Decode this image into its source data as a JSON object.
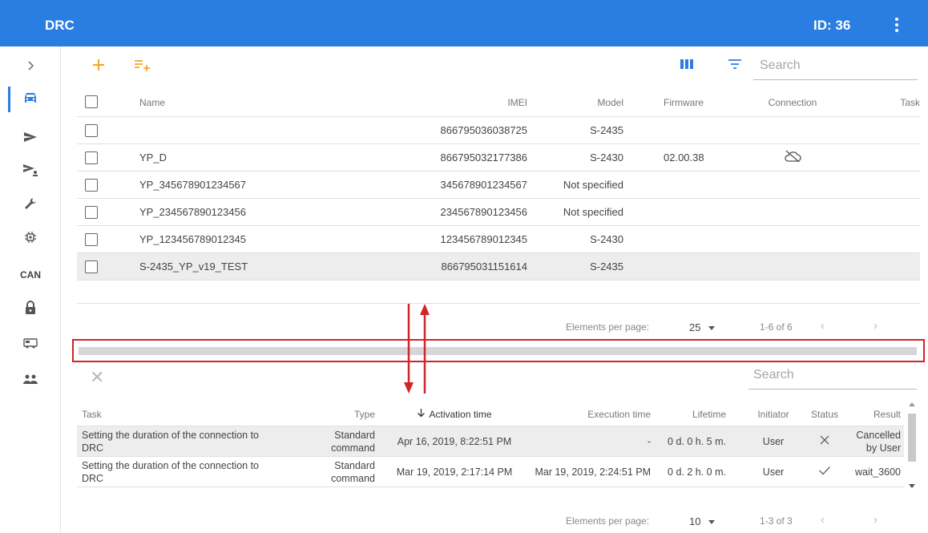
{
  "app": {
    "title": "DRC",
    "id_label": "ID: 36",
    "accent_color": "#2a7de1",
    "highlight_color": "#d0252a"
  },
  "sidebar": {
    "items": [
      {
        "name": "expand-icon"
      },
      {
        "name": "car-icon",
        "active": true
      },
      {
        "name": "send-icon"
      },
      {
        "name": "send-group-icon"
      },
      {
        "name": "wrench-icon"
      },
      {
        "name": "chip-icon"
      },
      {
        "name": "can-icon",
        "label": "CAN"
      },
      {
        "name": "lock-icon"
      },
      {
        "name": "truck-icon"
      },
      {
        "name": "users-icon"
      }
    ]
  },
  "toolbar": {
    "add_icon": "plus-icon",
    "add_list_icon": "playlist-add-icon",
    "columns_icon": "columns-icon",
    "filter_icon": "filter-icon",
    "search_placeholder": "Search"
  },
  "devices": {
    "columns": [
      "Name",
      "IMEI",
      "Model",
      "Firmware",
      "Connection",
      "Task"
    ],
    "rows": [
      {
        "name": "",
        "imei": "866795036038725",
        "model": "S-2435",
        "firmware": "",
        "connection": ""
      },
      {
        "name": "YP_D",
        "imei": "866795032177386",
        "model": "S-2430",
        "firmware": "02.00.38",
        "connection": "cloud-off-icon"
      },
      {
        "name": "YP_345678901234567",
        "imei": "345678901234567",
        "model": "Not specified",
        "firmware": "",
        "connection": ""
      },
      {
        "name": "YP_234567890123456",
        "imei": "234567890123456",
        "model": "Not specified",
        "firmware": "",
        "connection": ""
      },
      {
        "name": "YP_123456789012345",
        "imei": "123456789012345",
        "model": "S-2430",
        "firmware": "",
        "connection": ""
      },
      {
        "name": "S-2435_YP_v19_TEST",
        "imei": "866795031151614",
        "model": "S-2435",
        "firmware": "",
        "connection": ""
      }
    ],
    "pager": {
      "label": "Elements per page:",
      "per_page": "25",
      "range": "1-6 of 6"
    }
  },
  "tasks": {
    "search_placeholder": "Search",
    "columns": [
      "Task",
      "Type",
      "Activation time",
      "Execution time",
      "Lifetime",
      "Initiator",
      "Status",
      "Result"
    ],
    "rows": [
      {
        "task": "Setting the duration of the connection to DRC",
        "type": "Standard command",
        "activation": "Apr 16, 2019, 8:22:51 PM",
        "execution": "-",
        "lifetime": "0 d. 0 h. 5 m.",
        "initiator": "User",
        "status": "cancelled-icon",
        "result": "Cancelled by User"
      },
      {
        "task": "Setting the duration of the connection to DRC",
        "type": "Standard command",
        "activation": "Mar 19, 2019, 2:17:14 PM",
        "execution": "Mar 19, 2019, 2:24:51 PM",
        "lifetime": "0 d. 2 h. 0 m.",
        "initiator": "User",
        "status": "check-icon",
        "result": "wait_3600"
      }
    ],
    "pager": {
      "label": "Elements per page:",
      "per_page": "10",
      "range": "1-3 of 3"
    }
  }
}
